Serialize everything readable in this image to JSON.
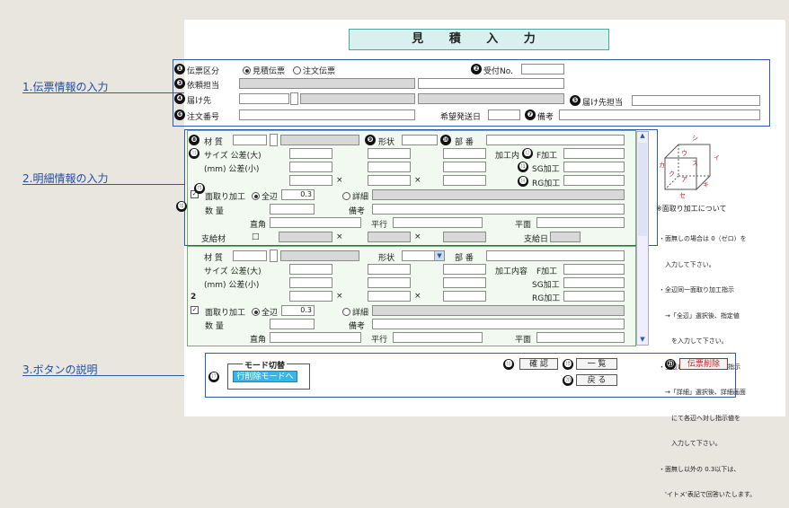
{
  "title": "見 積 入 力",
  "sections": {
    "s1": "1.伝票情報の入力",
    "s2": "2.明細情報の入力",
    "s3": "3.ボタンの説明"
  },
  "numbers": [
    "❶",
    "❷",
    "❸",
    "❹",
    "❺",
    "❻",
    "❼",
    "❽",
    "❾",
    "❿",
    "⓫",
    "⓬",
    "⓭",
    "⓮",
    "⓯",
    "⓰",
    "⓱",
    "⓲",
    "⓳",
    "⓴",
    "㉑"
  ],
  "header": {
    "denpyo_kubun": "伝票区分",
    "mitsumori": "見積伝票",
    "chumon": "注文伝票",
    "uketsuke": "受付No.",
    "irai": "依頼担当",
    "todoke": "届け先",
    "todoke_tanto": "届け先担当",
    "chumon_no": "注文番号",
    "kibo": "希望発送日",
    "biko": "備考"
  },
  "row1": {
    "zaishitsu": "材 質",
    "keijo": "形状",
    "buban": "部 番",
    "size_dai": "サイズ 公差(大)",
    "size_sho": "(mm) 公差(小)",
    "kakou": "加工内",
    "f": "F加工",
    "sg": "SG加工",
    "rg": "RG加工",
    "x": "×",
    "mentori": "面取り加工",
    "zenpen": "全辺",
    "zenpen_val": "0.3",
    "shosai": "詳細",
    "suryo": "数 量",
    "biko": "備考",
    "chokkaku": "直角",
    "heiko": "平行",
    "heimen": "平面",
    "shikyu": "支給材",
    "shikyubi": "支給日",
    "box": "□"
  },
  "row2": {
    "zaishitsu": "材 質",
    "keijo": "形状",
    "buban": "部 番",
    "size_dai": "サイズ 公差(大)",
    "size_sho": "(mm) 公差(小)",
    "kakou": "加工内容",
    "f": "F加工",
    "sg": "SG加工",
    "rg": "RG加工",
    "x": "×",
    "row_no": "2",
    "mentori": "面取り加工",
    "zenpen": "全辺",
    "zenpen_val": "0.3",
    "shosai": "詳細",
    "suryo": "数 量",
    "biko": "備考",
    "chokkaku": "直角",
    "heiko": "平行",
    "heimen": "平面",
    "check": "☑"
  },
  "side": {
    "labels": [
      "シ",
      "ウ",
      "カ",
      "イ",
      "ス",
      "ク",
      "ア",
      "キ",
      "セ"
    ],
    "caption": "※面取り加工について",
    "notes": [
      "・面無しの場合は 0（ゼロ）を",
      "　入力して下さい。",
      "・全辺同一面取り加工指示",
      "　→「全辺」選択後、指定値",
      "　　を入力して下さい。",
      "・全辺以外の面取り加工指示",
      "　→「詳細」選択後、詳細画面",
      "　　にて各辺へ対し指示値を",
      "　　入力して下さい。",
      "・面無し以外の 0.3以下は、",
      "　'イトメ'表記で回答いたします。"
    ]
  },
  "buttons": {
    "mode_group": "モード切替",
    "mode_btn": "行削除モードへ",
    "kakunin": "確 認",
    "ichiran": "一 覧",
    "modoru": "戻 る",
    "sakujo": "伝票削除"
  },
  "colors": {
    "accent": "#2a5ca8",
    "danger": "#c02020",
    "mode": "#39b6e8"
  }
}
